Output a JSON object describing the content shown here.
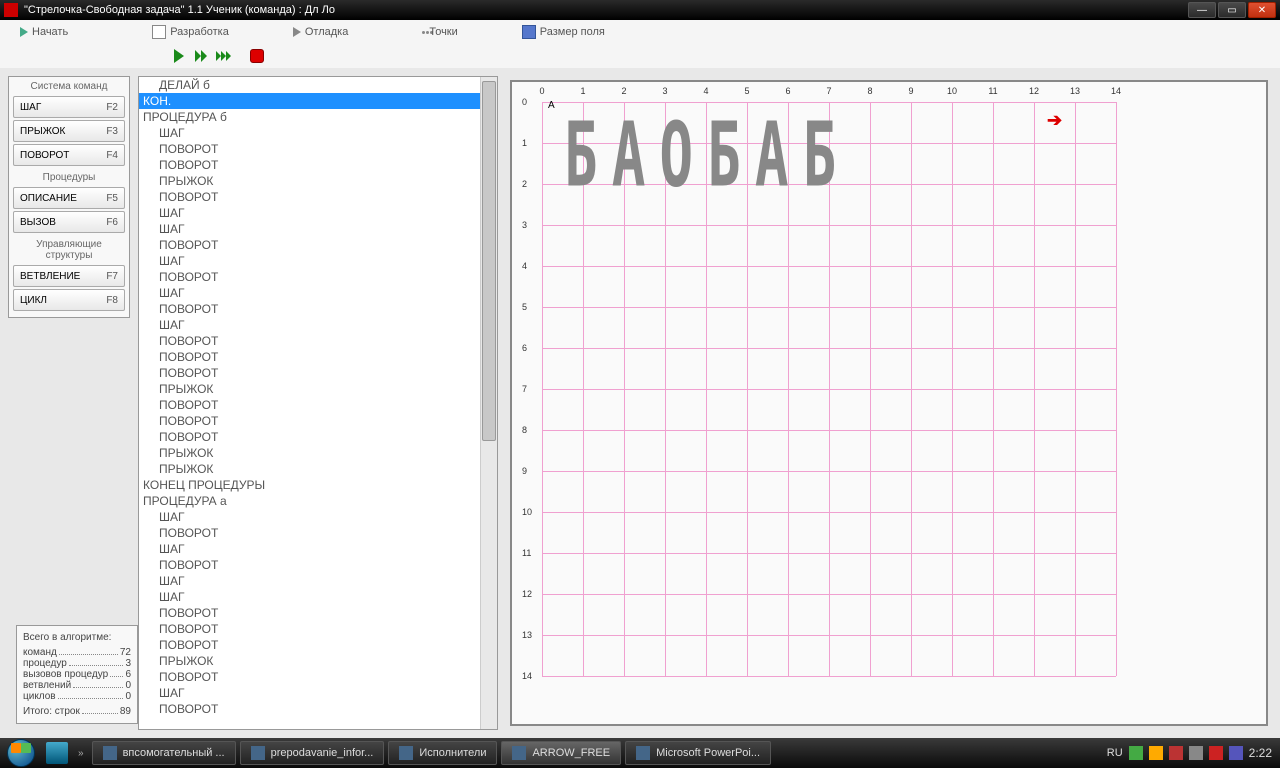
{
  "titlebar": {
    "text": "\"Стрелочка-Свободная задача\" 1.1     Ученик (команда) : Дл Ло"
  },
  "menu": {
    "start": "Начать",
    "develop": "Разработка",
    "debug": "Отладка",
    "points": "Точки",
    "fieldsize": "Размер поля"
  },
  "sidebar": {
    "system_label": "Система команд",
    "procedures_label": "Процедуры",
    "structures_label": "Управляющие структуры",
    "buttons": {
      "step": {
        "label": "ШАГ",
        "key": "F2"
      },
      "jump": {
        "label": "ПРЫЖОК",
        "key": "F3"
      },
      "turn": {
        "label": "ПОВОРОТ",
        "key": "F4"
      },
      "desc": {
        "label": "ОПИСАНИЕ",
        "key": "F5"
      },
      "call": {
        "label": "ВЫЗОВ",
        "key": "F6"
      },
      "branch": {
        "label": "ВЕТВЛЕНИЕ",
        "key": "F7"
      },
      "cycle": {
        "label": "ЦИКЛ",
        "key": "F8"
      }
    }
  },
  "stats": {
    "title": "Всего в алгоритме:",
    "rows": [
      {
        "label": "команд",
        "value": "72"
      },
      {
        "label": "процедур",
        "value": "3"
      },
      {
        "label": "вызовов процедур",
        "value": "6"
      },
      {
        "label": "ветвлений",
        "value": "0"
      },
      {
        "label": "циклов",
        "value": "0"
      }
    ],
    "footer_label": "Итого: строк",
    "footer_value": "89"
  },
  "code": {
    "lines": [
      {
        "t": "ДЕЛАЙ б",
        "i": 1,
        "sel": false
      },
      {
        "t": "КОН.",
        "i": 0,
        "sel": true
      },
      {
        "t": "ПРОЦЕДУРА б",
        "i": 0,
        "sel": false
      },
      {
        "t": "ШАГ",
        "i": 1,
        "sel": false
      },
      {
        "t": "ПОВОРОТ",
        "i": 1,
        "sel": false
      },
      {
        "t": "ПОВОРОТ",
        "i": 1,
        "sel": false
      },
      {
        "t": "ПРЫЖОК",
        "i": 1,
        "sel": false
      },
      {
        "t": "ПОВОРОТ",
        "i": 1,
        "sel": false
      },
      {
        "t": "ШАГ",
        "i": 1,
        "sel": false
      },
      {
        "t": "ШАГ",
        "i": 1,
        "sel": false
      },
      {
        "t": "ПОВОРОТ",
        "i": 1,
        "sel": false
      },
      {
        "t": "ШАГ",
        "i": 1,
        "sel": false
      },
      {
        "t": "ПОВОРОТ",
        "i": 1,
        "sel": false
      },
      {
        "t": "ШАГ",
        "i": 1,
        "sel": false
      },
      {
        "t": "ПОВОРОТ",
        "i": 1,
        "sel": false
      },
      {
        "t": "ШАГ",
        "i": 1,
        "sel": false
      },
      {
        "t": "ПОВОРОТ",
        "i": 1,
        "sel": false
      },
      {
        "t": "ПОВОРОТ",
        "i": 1,
        "sel": false
      },
      {
        "t": "ПОВОРОТ",
        "i": 1,
        "sel": false
      },
      {
        "t": "ПРЫЖОК",
        "i": 1,
        "sel": false
      },
      {
        "t": "ПОВОРОТ",
        "i": 1,
        "sel": false
      },
      {
        "t": "ПОВОРОТ",
        "i": 1,
        "sel": false
      },
      {
        "t": "ПОВОРОТ",
        "i": 1,
        "sel": false
      },
      {
        "t": "ПРЫЖОК",
        "i": 1,
        "sel": false
      },
      {
        "t": "ПРЫЖОК",
        "i": 1,
        "sel": false
      },
      {
        "t": "КОНЕЦ ПРОЦЕДУРЫ",
        "i": 0,
        "sel": false
      },
      {
        "t": "ПРОЦЕДУРА а",
        "i": 0,
        "sel": false
      },
      {
        "t": "ШАГ",
        "i": 1,
        "sel": false
      },
      {
        "t": "ПОВОРОТ",
        "i": 1,
        "sel": false
      },
      {
        "t": "ШАГ",
        "i": 1,
        "sel": false
      },
      {
        "t": "ПОВОРОТ",
        "i": 1,
        "sel": false
      },
      {
        "t": "ШАГ",
        "i": 1,
        "sel": false
      },
      {
        "t": "ШАГ",
        "i": 1,
        "sel": false
      },
      {
        "t": "ПОВОРОТ",
        "i": 1,
        "sel": false
      },
      {
        "t": "ПОВОРОТ",
        "i": 1,
        "sel": false
      },
      {
        "t": "ПОВОРОТ",
        "i": 1,
        "sel": false
      },
      {
        "t": "ПРЫЖОК",
        "i": 1,
        "sel": false
      },
      {
        "t": "ПОВОРОТ",
        "i": 1,
        "sel": false
      },
      {
        "t": "ШАГ",
        "i": 1,
        "sel": false
      },
      {
        "t": "ПОВОРОТ",
        "i": 1,
        "sel": false
      }
    ]
  },
  "canvas": {
    "cols": 15,
    "rows": 15,
    "point_label": "A",
    "drawn_text": "БАОБАБ"
  },
  "taskbar": {
    "items": [
      {
        "label": "впсомогательный ...",
        "active": false
      },
      {
        "label": "prepodavanie_infor...",
        "active": false
      },
      {
        "label": "Исполнители",
        "active": false
      },
      {
        "label": "ARROW_FREE",
        "active": true
      },
      {
        "label": "Microsoft PowerPoi...",
        "active": false
      }
    ],
    "lang": "RU",
    "time": "2:22"
  }
}
